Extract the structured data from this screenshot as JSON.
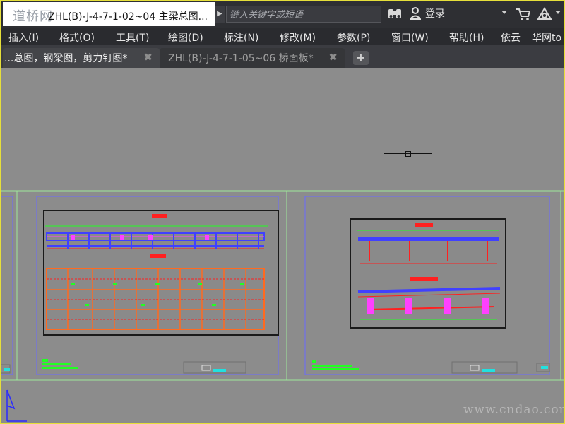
{
  "titlebar": {
    "logo_text": "道桥网",
    "document_title": "ZHL(B)-J-4-7-1-02~04 主梁总图...",
    "search_placeholder": "键入关键字或短语",
    "login_label": "登录"
  },
  "menu": {
    "items": [
      "插入(I)",
      "格式(O)",
      "工具(T)",
      "绘图(D)",
      "标注(N)",
      "修改(M)",
      "参数(P)",
      "窗口(W)",
      "帮助(H)",
      "依云",
      "华网to"
    ]
  },
  "tabs": [
    {
      "label": "...总图，钢梁图，剪力钉图*",
      "active": true
    },
    {
      "label": "ZHL(B)-J-4-7-1-05~06 桥面板*",
      "active": false
    }
  ],
  "colors": {
    "canvas": "#8c8c8c",
    "titlebar": "#2e2f33",
    "frame_green": "#9ee89a",
    "frame_blue": "#5555ff",
    "accent_red": "#ff2020",
    "accent_green": "#22ff22"
  },
  "watermark": "www.cndao.com"
}
